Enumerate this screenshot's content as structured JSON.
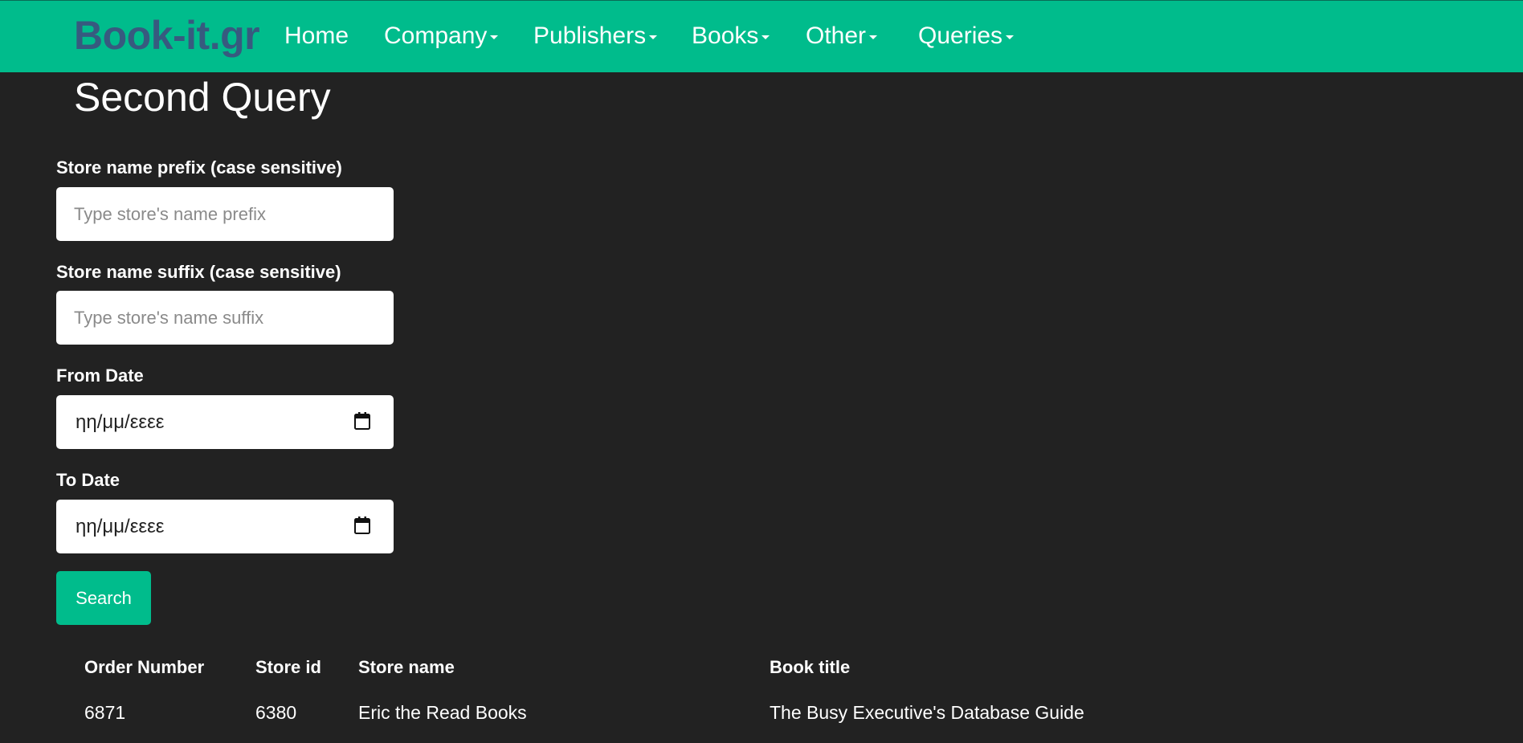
{
  "navbar": {
    "brand": "Book-it.gr",
    "items": [
      {
        "label": "Home",
        "dropdown": false
      },
      {
        "label": "Company",
        "dropdown": true
      },
      {
        "label": "Publishers",
        "dropdown": true
      },
      {
        "label": "Books",
        "dropdown": true
      },
      {
        "label": "Other",
        "dropdown": true
      },
      {
        "label": "Queries",
        "dropdown": true
      }
    ]
  },
  "page": {
    "title": "Second Query"
  },
  "form": {
    "prefix_label": "Store name prefix (case sensitive)",
    "prefix_placeholder": "Type store's name prefix",
    "prefix_value": "",
    "suffix_label": "Store name suffix (case sensitive)",
    "suffix_placeholder": "Type store's name suffix",
    "suffix_value": "",
    "from_label": "From Date",
    "from_value": "ηη/μμ/εεεε",
    "to_label": "To Date",
    "to_value": "ηη/μμ/εεεε",
    "search_label": "Search"
  },
  "results": {
    "columns": [
      "Order Number",
      "Store id",
      "Store name",
      "Book title"
    ],
    "rows": [
      [
        "6871",
        "6380",
        "Eric the Read Books",
        "The Busy Executive's Database Guide"
      ]
    ]
  },
  "colors": {
    "accent": "#00bc8c",
    "brand": "#375a7f",
    "background": "#222222"
  },
  "icons": {
    "calendar": "calendar-icon",
    "caret": "caret-down-icon"
  }
}
